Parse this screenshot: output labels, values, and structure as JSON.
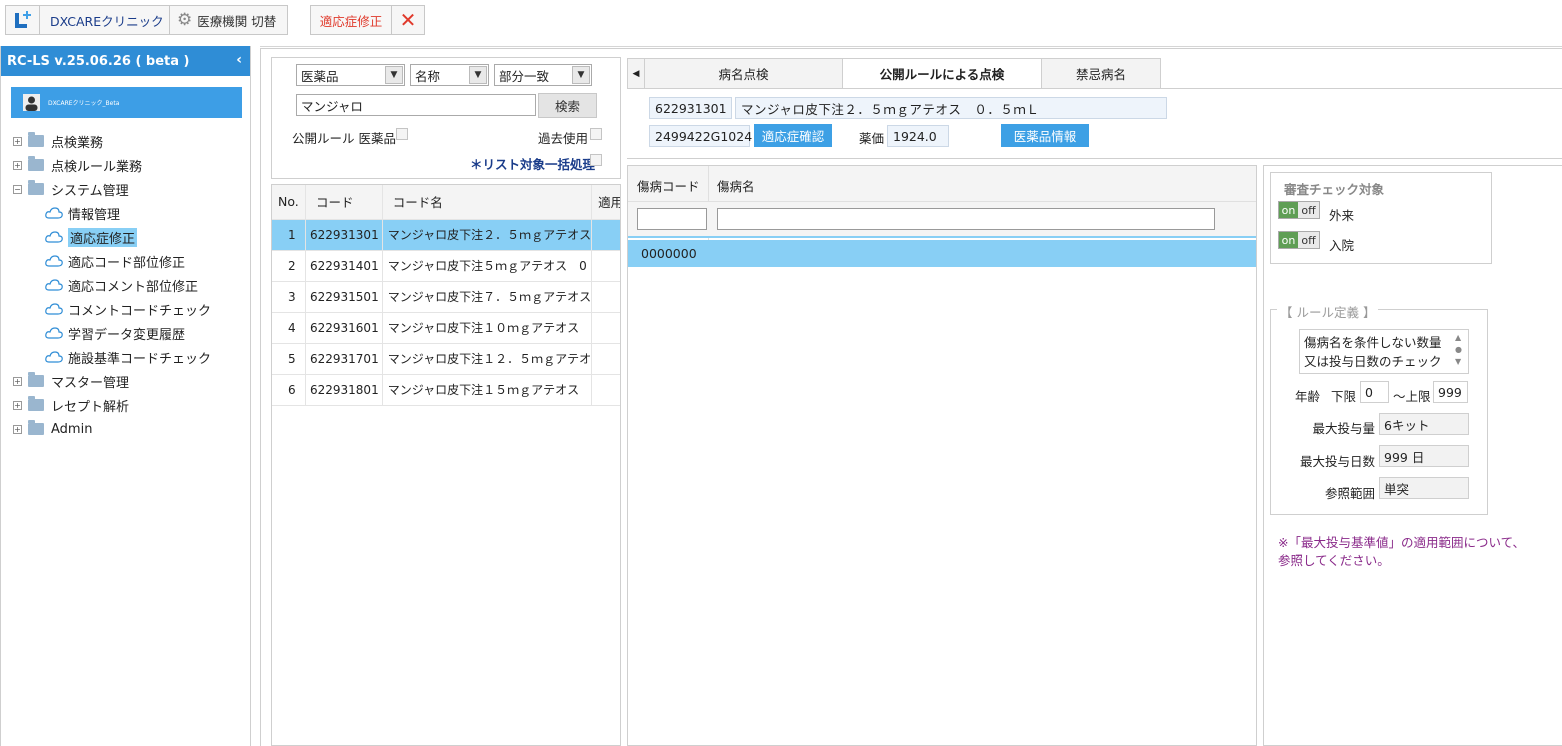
{
  "toolbar": {
    "clinic_label": "DXCAREクリニック",
    "switch_label": "医療機関 切替",
    "active_tab": "適応症修正"
  },
  "sidebar": {
    "title": "RC-LS v.25.06.26 ( beta )",
    "user_name": "DXCAREクリニック_Beta",
    "items": [
      {
        "label": "点検業務",
        "expand": "+"
      },
      {
        "label": "点検ルール業務",
        "expand": "+"
      },
      {
        "label": "システム管理",
        "expand": "−"
      },
      {
        "label": "情報管理"
      },
      {
        "label": "適応症修正"
      },
      {
        "label": "適応コード部位修正"
      },
      {
        "label": "適応コメント部位修正"
      },
      {
        "label": "コメントコードチェック"
      },
      {
        "label": "学習データ変更履歴"
      },
      {
        "label": "施設基準コードチェック"
      },
      {
        "label": "マスター管理",
        "expand": "+"
      },
      {
        "label": "レセプト解析",
        "expand": "+"
      },
      {
        "label": "Admin",
        "expand": "+"
      }
    ]
  },
  "search": {
    "category": "医薬品",
    "field": "名称",
    "match": "部分一致",
    "query": "マンジャロ",
    "search_button": "検索",
    "public_rule_label": "公開ルール 医薬品",
    "past_use_label": "過去使用",
    "bulk_label": "＊リスト対象一括処理"
  },
  "drug_table": {
    "headers": [
      "No.",
      "コード",
      "コード名",
      "適用"
    ],
    "rows": [
      {
        "no": "1",
        "code": "622931301",
        "name": "マンジャロ皮下注２．５ｍｇアテオス"
      },
      {
        "no": "2",
        "code": "622931401",
        "name": "マンジャロ皮下注５ｍｇアテオス　0"
      },
      {
        "no": "3",
        "code": "622931501",
        "name": "マンジャロ皮下注７．５ｍｇアテオス"
      },
      {
        "no": "4",
        "code": "622931601",
        "name": "マンジャロ皮下注１０ｍｇアテオス"
      },
      {
        "no": "5",
        "code": "622931701",
        "name": "マンジャロ皮下注１２．５ｍｇアテオ"
      },
      {
        "no": "6",
        "code": "622931801",
        "name": "マンジャロ皮下注１５ｍｇアテオス"
      }
    ]
  },
  "tabs": [
    "病名点検",
    "公開ルールによる点検",
    "禁忌病名"
  ],
  "detail": {
    "code": "622931301",
    "name": "マンジャロ皮下注２．５ｍｇアテオス　０．５ｍＬ",
    "yj_code": "2499422G1024",
    "indication_button": "適応症確認",
    "price_label": "薬価",
    "price": "1924.0",
    "drug_info_button": "医薬品情報"
  },
  "disease_table": {
    "headers": [
      "傷病コード",
      "傷病名"
    ],
    "row_code": "0000000"
  },
  "check_target": {
    "title": "審査チェック対象",
    "on": "on",
    "off": "off",
    "outpatient": "外来",
    "inpatient": "入院"
  },
  "rule": {
    "title": "【 ルール定義 】",
    "description": "傷病名を条件しない数量又は投与日数のチェック",
    "age_label": "年齢",
    "lower_label": "下限",
    "lower": "0",
    "upper_label": "～上限",
    "upper": "999",
    "max_dose_label": "最大投与量",
    "max_dose": "6キット",
    "max_days_label": "最大投与日数",
    "max_days": "999 日",
    "scope_label": "参照範囲",
    "scope": "単突"
  },
  "note": "※「最大投与基準値」の適用範囲について、参照してください。",
  "colors": {
    "accent": "#2f8dd6",
    "selected_row": "#88cff5",
    "note": "#8a2a8a",
    "active_tab_text": "#e0392b"
  }
}
